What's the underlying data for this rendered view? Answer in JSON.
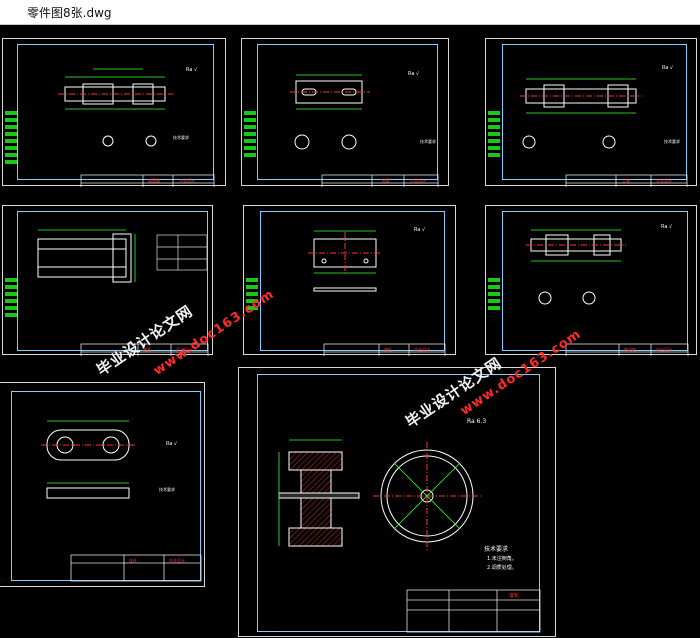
{
  "window": {
    "title": "零件图8张.dwg"
  },
  "colors": {
    "outline": "#d8d8d8",
    "frame": "#7fd0ff",
    "dim": "#33ff33",
    "part": "#ffffff",
    "center": "#ff3030",
    "table": "#e0e0e0",
    "title_text": "#ff3333",
    "watermark_white": "#f2f2f2",
    "watermark_red": "#ff2a2a"
  },
  "watermarks": [
    {
      "site": "www.doc163.com",
      "brand": "毕业设计论文网"
    },
    {
      "site": "www.doc163.com",
      "brand": "毕业设计论文网"
    }
  ],
  "sheets": [
    {
      "name": "drawing-sheet-shaft-1"
    },
    {
      "name": "drawing-sheet-spacer"
    },
    {
      "name": "drawing-sheet-long-shaft"
    },
    {
      "name": "drawing-sheet-sleeve"
    },
    {
      "name": "drawing-sheet-plate"
    },
    {
      "name": "drawing-sheet-shaft-2"
    },
    {
      "name": "drawing-sheet-link"
    },
    {
      "name": "drawing-sheet-wheel"
    }
  ],
  "wheel_sheet": {
    "roughness": "Ra 6.3",
    "notes_title": "技术要求",
    "notes": [
      "1.未注倒角。",
      "2.调质处理。"
    ],
    "part_label": "滚轮"
  }
}
